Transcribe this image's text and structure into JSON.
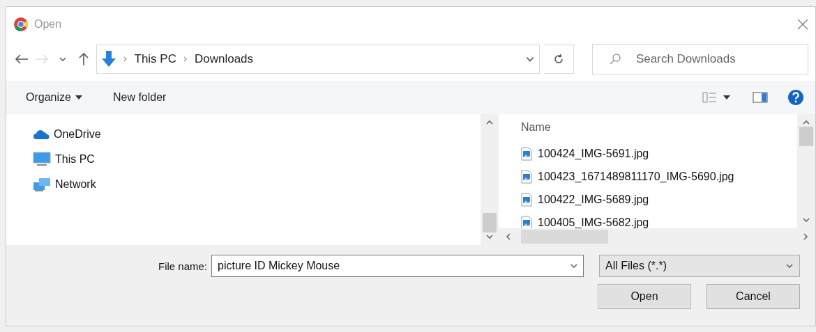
{
  "window": {
    "title": "Open"
  },
  "address_bar": {
    "path": [
      {
        "label": "This PC"
      },
      {
        "label": "Downloads"
      }
    ]
  },
  "search": {
    "placeholder": "Search Downloads"
  },
  "toolbar": {
    "organize": "Organize",
    "new_folder": "New folder"
  },
  "nav_pane": {
    "items": [
      {
        "label": "OneDrive",
        "kind": "cloud"
      },
      {
        "label": "This PC",
        "kind": "computer"
      },
      {
        "label": "Network",
        "kind": "network"
      }
    ]
  },
  "file_list": {
    "column": "Name",
    "files": [
      {
        "name": "100424_IMG-5691.jpg"
      },
      {
        "name": "100423_1671489811170_IMG-5690.jpg"
      },
      {
        "name": "100422_IMG-5689.jpg"
      },
      {
        "name": "100405_IMG-5682.jpg"
      }
    ]
  },
  "file_name": {
    "label": "File name:",
    "value": "picture ID Mickey Mouse"
  },
  "file_type": {
    "value": "All Files (*.*)"
  },
  "buttons": [
    {
      "label": "Open",
      "kind": "primary"
    },
    {
      "label": "Cancel",
      "kind": "secondary"
    }
  ]
}
